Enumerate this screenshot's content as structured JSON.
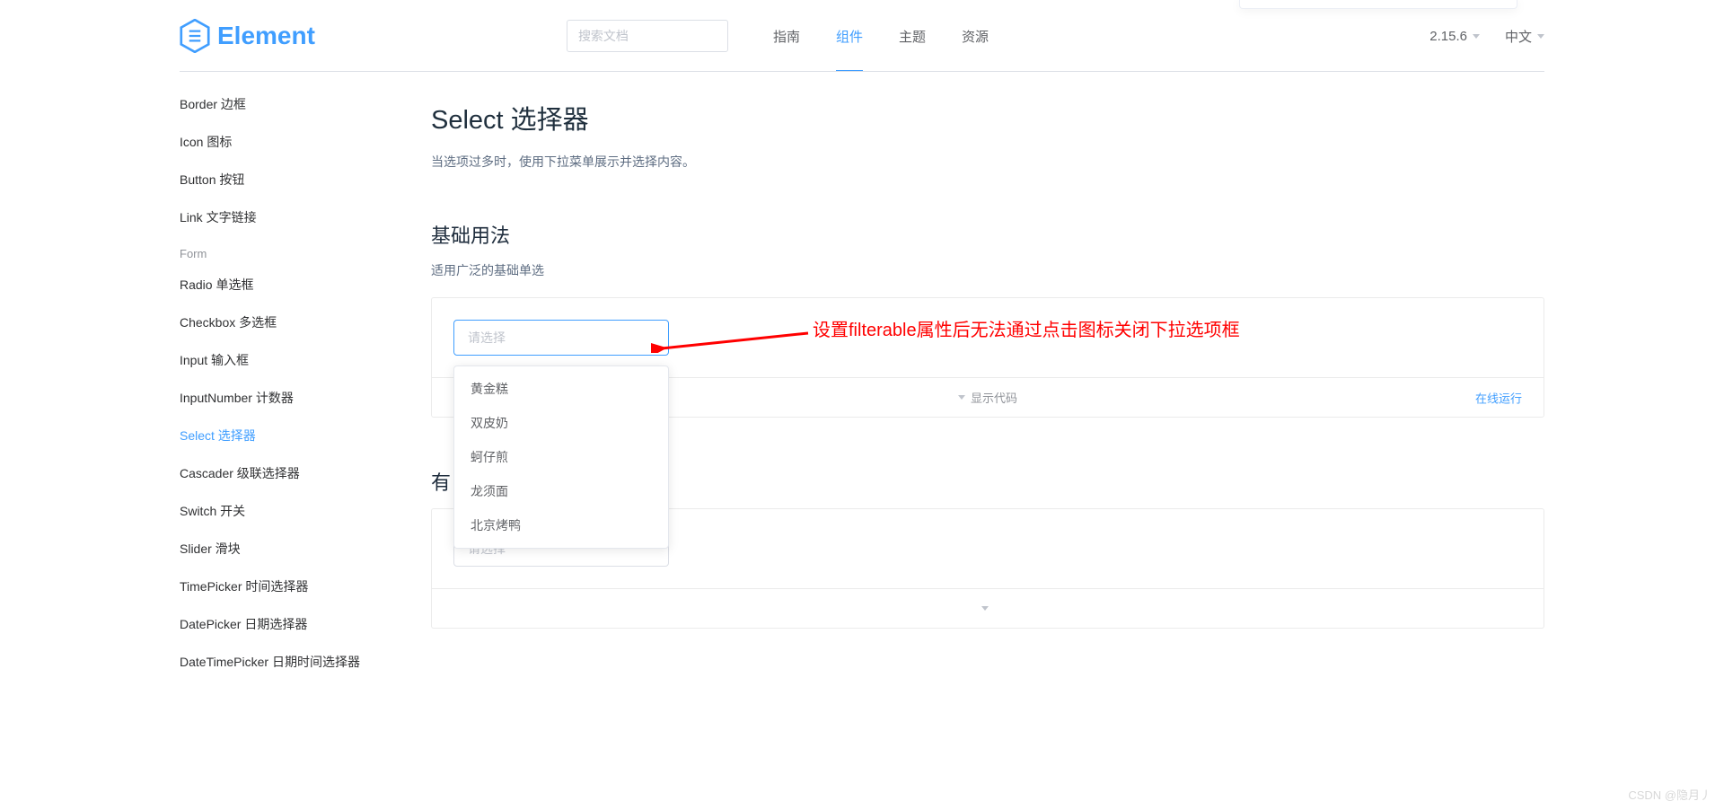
{
  "header": {
    "logo_text": "Element",
    "search_placeholder": "搜索文档",
    "nav": [
      {
        "label": "指南",
        "active": false
      },
      {
        "label": "组件",
        "active": true
      },
      {
        "label": "主题",
        "active": false
      },
      {
        "label": "资源",
        "active": false
      }
    ],
    "version": "2.15.6",
    "language": "中文"
  },
  "sidebar": {
    "items_top": [
      "Border 边框",
      "Icon 图标",
      "Button 按钮",
      "Link 文字链接"
    ],
    "group_form_label": "Form",
    "items_form": [
      {
        "label": "Radio 单选框",
        "active": false
      },
      {
        "label": "Checkbox 多选框",
        "active": false
      },
      {
        "label": "Input 输入框",
        "active": false
      },
      {
        "label": "InputNumber 计数器",
        "active": false
      },
      {
        "label": "Select 选择器",
        "active": true
      },
      {
        "label": "Cascader 级联选择器",
        "active": false
      },
      {
        "label": "Switch 开关",
        "active": false
      },
      {
        "label": "Slider 滑块",
        "active": false
      },
      {
        "label": "TimePicker 时间选择器",
        "active": false
      },
      {
        "label": "DatePicker 日期选择器",
        "active": false
      },
      {
        "label": "DateTimePicker 日期时间选择器",
        "active": false
      }
    ]
  },
  "page": {
    "title": "Select 选择器",
    "desc": "当选项过多时，使用下拉菜单展示并选择内容。",
    "section1_title": "基础用法",
    "section1_desc": "适用广泛的基础单选",
    "select_placeholder": "请选择",
    "dropdown_options": [
      "黄金糕",
      "双皮奶",
      "蚵仔煎",
      "龙须面",
      "北京烤鸭"
    ],
    "show_code_label": "显示代码",
    "run_online_label": "在线运行",
    "section2_title_prefix": "有",
    "select2_placeholder": "请选择"
  },
  "annotation": "设置filterable属性后无法通过点击图标关闭下拉选项框",
  "watermark": "CSDN @隐月丿"
}
